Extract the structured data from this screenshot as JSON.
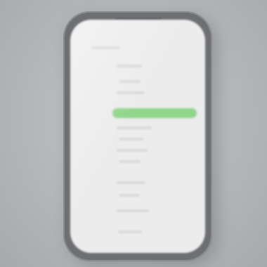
{
  "scene": {
    "description_colors": {
      "background": "#b4b6b8",
      "phone_frame": "#6d6f72",
      "screen": "#ececec",
      "highlight_bar": "#8fd58a"
    },
    "icons": [
      "smartphone-icon"
    ]
  }
}
